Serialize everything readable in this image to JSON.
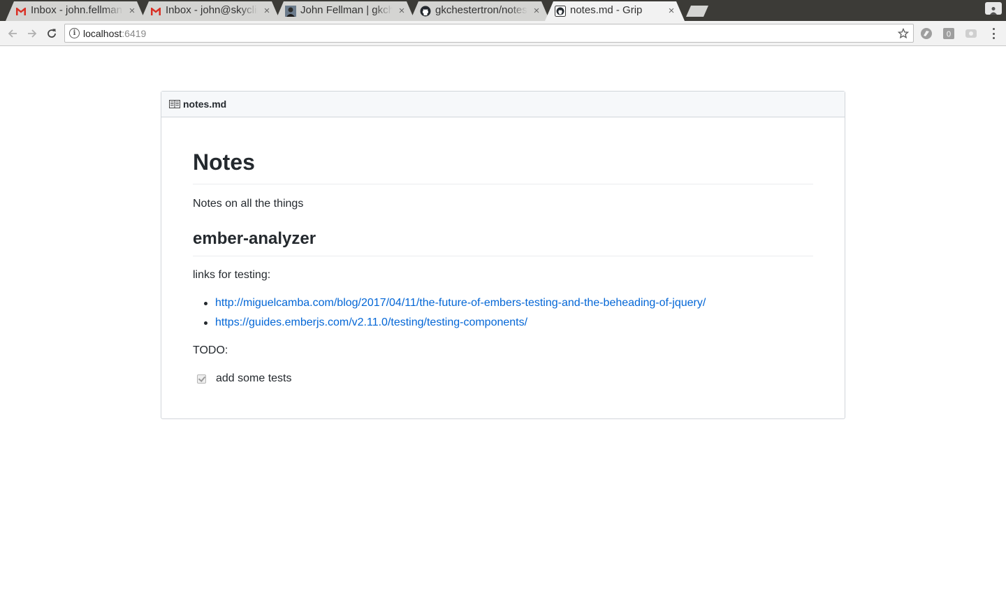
{
  "browser": {
    "tabs": [
      {
        "title": "Inbox - john.fellman@...",
        "favicon": "gmail-icon",
        "active": false
      },
      {
        "title": "Inbox - john@skyclimb...",
        "favicon": "gmail-icon",
        "active": false
      },
      {
        "title": "John Fellman | gkchester...",
        "favicon": "avatar-icon",
        "active": false
      },
      {
        "title": "gkchestertron/notes...",
        "favicon": "github-icon",
        "active": false
      },
      {
        "title": "notes.md - Grip",
        "favicon": "github-icon",
        "active": true
      }
    ],
    "close_glyph": "×",
    "url_host": "localhost",
    "url_port": ":6419"
  },
  "readme": {
    "filename": "notes.md",
    "h1": "Notes",
    "intro": "Notes on all the things",
    "h2": "ember-analyzer",
    "links_label": "links for testing:",
    "links": [
      "http://miguelcamba.com/blog/2017/04/11/the-future-of-embers-testing-and-the-beheading-of-jquery/",
      "https://guides.emberjs.com/v2.11.0/testing/testing-components/"
    ],
    "todo_label": "TODO:",
    "task": {
      "label": "add some tests",
      "checked": true
    }
  },
  "colors": {
    "link": "#0366d6",
    "text": "#24292e",
    "gmail_red": "#d93025"
  }
}
